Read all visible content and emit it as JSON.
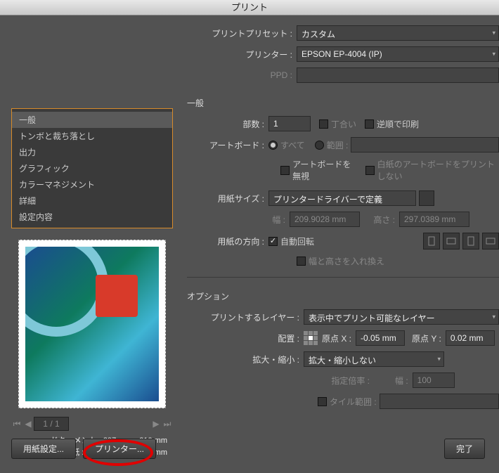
{
  "window": {
    "title": "プリント"
  },
  "presets": {
    "label": "プリントプリセット :",
    "value": "カスタム",
    "printer_label": "プリンター :",
    "printer_value": "EPSON EP-4004 (IP)",
    "ppd_label": "PPD :",
    "ppd_value": ""
  },
  "categories": {
    "items": [
      "一般",
      "トンボと裁ち落とし",
      "出力",
      "グラフィック",
      "カラーマネジメント",
      "詳細",
      "設定内容"
    ],
    "selected_index": 0
  },
  "pager": {
    "current": "1",
    "total": "1"
  },
  "doc_info": {
    "document": "ドキュメント : 297 mm x 210 mm",
    "paper": "用紙 : 209.9 mm x 297.04 mm"
  },
  "general": {
    "title": "一般",
    "copies_label": "部数 :",
    "copies_value": "1",
    "collate": "丁合い",
    "reverse": "逆順で印刷",
    "artboard_label": "アートボード :",
    "artboard_all": "すべて",
    "artboard_range": "範囲 :",
    "artboard_range_value": "",
    "ignore_artboard": "アートボードを無視",
    "blank_artboard": "白紙のアートボードをプリントしない",
    "paper_size_label": "用紙サイズ :",
    "paper_size_value": "プリンタードライバーで定義",
    "width_label": "幅 :",
    "width_value": "209.9028 mm",
    "height_label": "高さ :",
    "height_value": "297.0389 mm",
    "orientation_label": "用紙の方向 :",
    "auto_rotate": "自動回転",
    "transverse": "幅と高さを入れ換え"
  },
  "options": {
    "title": "オプション",
    "print_layers_label": "プリントするレイヤー :",
    "print_layers_value": "表示中でプリント可能なレイヤー",
    "placement_label": "配置 :",
    "origin_x_label": "原点 X :",
    "origin_x_value": "-0.05 mm",
    "origin_y_label": "原点 Y :",
    "origin_y_value": "0.02 mm",
    "scale_label": "拡大・縮小 :",
    "scale_value": "拡大・縮小しない",
    "scale_ratio_label": "指定倍率 :",
    "scale_width_label": "幅 :",
    "scale_width_value": "100",
    "tile_range": "タイル範囲 :",
    "tile_range_value": ""
  },
  "buttons": {
    "page_setup": "用紙設定...",
    "printer": "プリンター...",
    "done": "完了"
  }
}
